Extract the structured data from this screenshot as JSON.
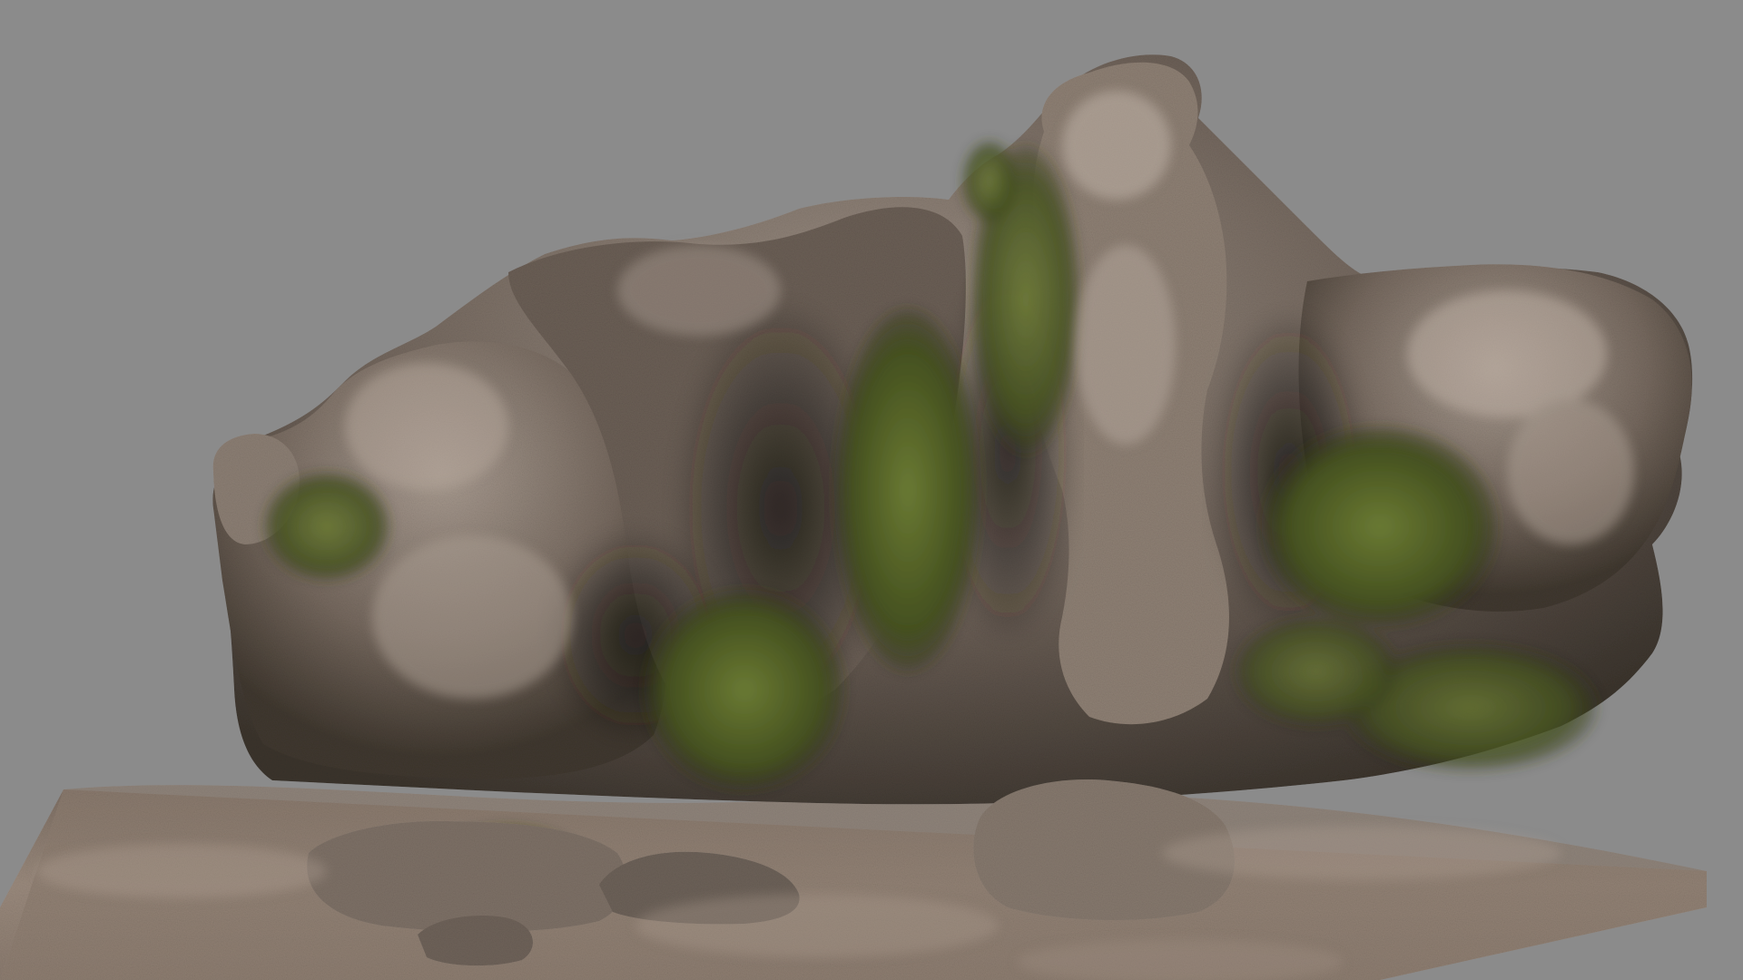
{
  "scene": {
    "background_color": "#8b8b8b",
    "ground_color": "#8f7f72",
    "rock_base_color": "#6e6259",
    "rock_highlight_color": "#a89a8e",
    "rock_shadow_color": "#2e2a24",
    "moss_color": "#5b6b2c",
    "moss_dark_color": "#36401a"
  }
}
